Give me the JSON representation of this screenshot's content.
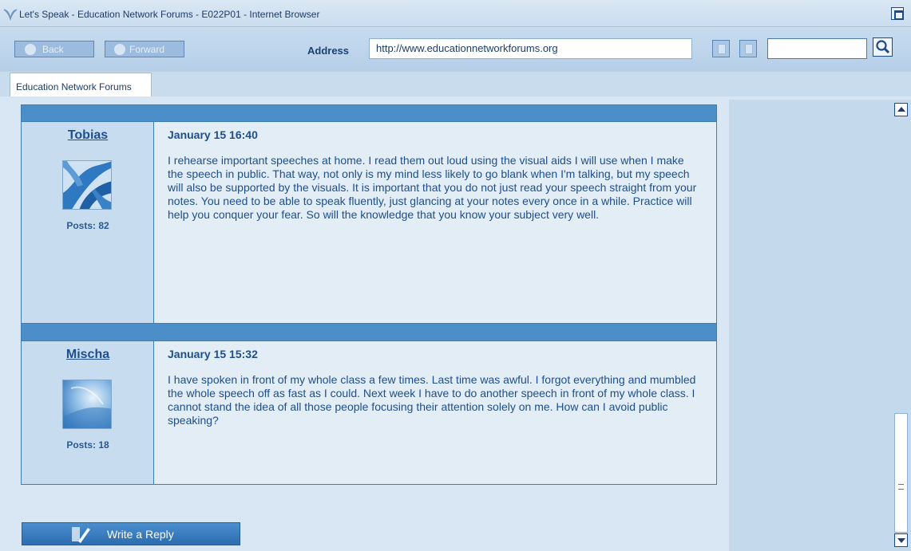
{
  "window": {
    "title": "Let's Speak - Education Network Forums - E022P01 - Internet Browser"
  },
  "toolbar": {
    "back_label": "Back",
    "forward_label": "Forward",
    "address_label": "Address",
    "address_value": "http://www.educationnetworkforums.org",
    "search_value": ""
  },
  "tabs": [
    {
      "label": "Education Network Forums"
    }
  ],
  "posts": [
    {
      "author": "Tobias",
      "posts_count": "Posts: 82",
      "date": "January 15 16:40",
      "text": "I rehearse important speeches at home. I read them out loud using the visual aids I will use when I make the speech in public. That way, not only is my mind less likely to go blank when I'm talking, but my speech will also be supported by the visuals. It is important that you do not just read your speech straight from your notes. You need to be able to speak fluently, just glancing at your notes every once in a while. Practice will help you conquer your fear. So will the knowledge that you know your subject very well."
    },
    {
      "author": "Mischa",
      "posts_count": "Posts: 18",
      "date": "January 15 15:32",
      "text": "I have spoken in front of my whole class a few times. Last time was awful. I forgot everything and mumbled the whole speech off as fast as I could. Next week I have to do another speech in front of my whole class. I cannot stand the idea of all those people focusing their attention solely on me. How can I avoid public speaking?"
    }
  ],
  "reply_button": {
    "label": "Write a Reply"
  },
  "colors": {
    "accent": "#4c8ec8",
    "text": "#1e4f8c",
    "background": "#d8e7f3"
  },
  "icons": {
    "app": "wing-logo-icon",
    "maximize": "maximize-icon",
    "search": "magnifier-icon",
    "reply": "pen-icon"
  }
}
